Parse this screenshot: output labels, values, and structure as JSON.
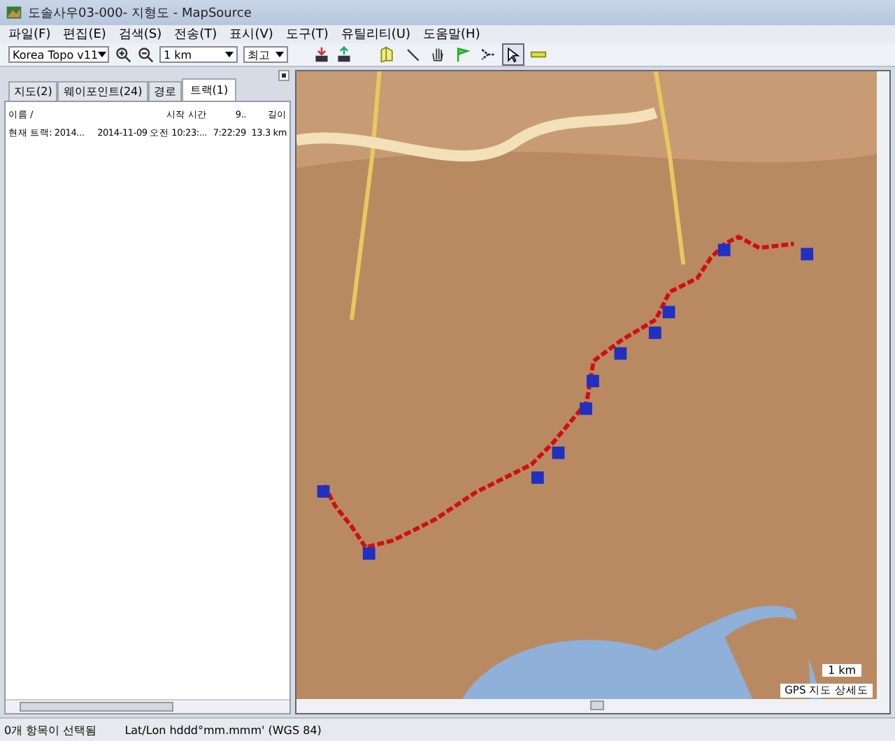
{
  "window": {
    "title": "도솔사우03-000- 지형도 - MapSource"
  },
  "menu": [
    "파일(F)",
    "편집(E)",
    "검색(S)",
    "전송(T)",
    "표시(V)",
    "도구(T)",
    "유틸리티(U)",
    "도움말(H)"
  ],
  "toolbar": {
    "map_product": "Korea Topo v11",
    "zoom_scale": "1 km",
    "detail": "최고",
    "tools": [
      {
        "kind": "map",
        "selected": false
      },
      {
        "kind": "zoom",
        "selected": false
      },
      {
        "kind": "hand",
        "selected": false
      },
      {
        "kind": "flag",
        "selected": false
      },
      {
        "kind": "route",
        "selected": false
      },
      {
        "kind": "pointer",
        "selected": true
      },
      {
        "kind": "measure",
        "selected": false
      }
    ]
  },
  "tabs": [
    {
      "label": "지도(2)",
      "selected": false
    },
    {
      "label": "웨이포인트(24)",
      "selected": false
    },
    {
      "label": "경로",
      "selected": false
    },
    {
      "label": "트랙(1)",
      "selected": true
    }
  ],
  "table": {
    "columns": [
      "이름 /",
      "시작 시간",
      "9..",
      "길이"
    ],
    "rows": [
      [
        "현재 트랙: 2014...",
        "2014-11-09 오전 10:23:...",
        "7:22:29",
        "13.3 km"
      ]
    ]
  },
  "map": {
    "scale": "1 km",
    "layer_label": "GPS 지도 상세도"
  },
  "status_bar": [
    "0개 항목이 선택됨",
    "Lat/Lon hddd°mm.mmm' (WGS 84)"
  ]
}
